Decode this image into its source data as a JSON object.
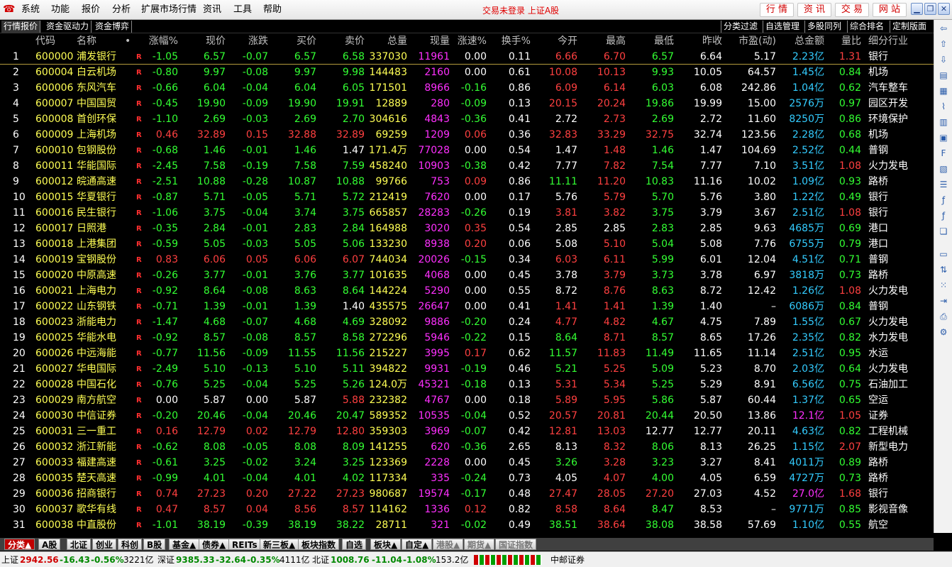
{
  "menu": {
    "logo": "☎",
    "items": [
      "系统",
      "功能",
      "报价",
      "分析",
      "扩展市场行情",
      "资讯",
      "工具",
      "帮助"
    ],
    "login_status": "交易未登录 上证A股",
    "trade_buttons": [
      "行 情",
      "资 讯",
      "交 易",
      "网 站"
    ]
  },
  "tabs": {
    "left": [
      "行情报价",
      "资金驱动力",
      "资金博弈"
    ],
    "right": [
      "分类过滤",
      "自选管理",
      "多股同列",
      "综合排名",
      "定制版面"
    ]
  },
  "columns": [
    "代码",
    "名称",
    "•",
    "涨幅%",
    "现价",
    "涨跌",
    "买价",
    "卖价",
    "总量",
    "现量",
    "涨速%",
    "换手%",
    "今开",
    "最高",
    "最低",
    "昨收",
    "市盈(动)",
    "总金额",
    "量比",
    "细分行业"
  ],
  "r_mark": "R",
  "rows": [
    {
      "no": "1",
      "code": "600000",
      "name": "浦发银行",
      "pct": "-1.05",
      "price": "6.57",
      "chg": "-0.07",
      "bid": "6.57",
      "ask": "6.58",
      "vol": "337030",
      "cur": "11961",
      "spd": "0.00",
      "turn": "0.11",
      "open": "6.66",
      "high": "6.70",
      "low": "6.57",
      "prev": "6.64",
      "pe": "5.17",
      "amt_n": "2.23",
      "amt_u": "亿",
      "ratio": "1.31",
      "ind": "银行"
    },
    {
      "no": "2",
      "code": "600004",
      "name": "白云机场",
      "pct": "-0.80",
      "price": "9.97",
      "chg": "-0.08",
      "bid": "9.97",
      "ask": "9.98",
      "vol": "144483",
      "cur": "2160",
      "spd": "0.00",
      "turn": "0.61",
      "open": "10.08",
      "high": "10.13",
      "low": "9.93",
      "prev": "10.05",
      "pe": "64.57",
      "amt_n": "1.45",
      "amt_u": "亿",
      "ratio": "0.84",
      "ind": "机场"
    },
    {
      "no": "3",
      "code": "600006",
      "name": "东风汽车",
      "pct": "-0.66",
      "price": "6.04",
      "chg": "-0.04",
      "bid": "6.04",
      "ask": "6.05",
      "vol": "171501",
      "cur": "8966",
      "spd": "-0.16",
      "turn": "0.86",
      "open": "6.09",
      "high": "6.14",
      "low": "6.03",
      "prev": "6.08",
      "pe": "242.86",
      "amt_n": "1.04",
      "amt_u": "亿",
      "ratio": "0.62",
      "ind": "汽车整车"
    },
    {
      "no": "4",
      "code": "600007",
      "name": "中国国贸",
      "pct": "-0.45",
      "price": "19.90",
      "chg": "-0.09",
      "bid": "19.90",
      "ask": "19.91",
      "vol": "12889",
      "cur": "280",
      "spd": "-0.09",
      "turn": "0.13",
      "open": "20.15",
      "high": "20.24",
      "low": "19.86",
      "prev": "19.99",
      "pe": "15.00",
      "amt_n": "2576",
      "amt_u": "万",
      "ratio": "0.97",
      "ind": "园区开发"
    },
    {
      "no": "5",
      "code": "600008",
      "name": "首创环保",
      "pct": "-1.10",
      "price": "2.69",
      "chg": "-0.03",
      "bid": "2.69",
      "ask": "2.70",
      "vol": "304616",
      "cur": "4843",
      "spd": "-0.36",
      "turn": "0.41",
      "open": "2.72",
      "high": "2.73",
      "low": "2.69",
      "prev": "2.72",
      "pe": "11.60",
      "amt_n": "8250",
      "amt_u": "万",
      "ratio": "0.86",
      "ind": "环境保护"
    },
    {
      "no": "6",
      "code": "600009",
      "name": "上海机场",
      "pct": "0.46",
      "price": "32.89",
      "chg": "0.15",
      "bid": "32.88",
      "ask": "32.89",
      "vol": "69259",
      "cur": "1209",
      "spd": "0.06",
      "turn": "0.36",
      "open": "32.83",
      "high": "33.29",
      "low": "32.75",
      "prev": "32.74",
      "pe": "123.56",
      "amt_n": "2.28",
      "amt_u": "亿",
      "ratio": "0.68",
      "ind": "机场"
    },
    {
      "no": "7",
      "code": "600010",
      "name": "包钢股份",
      "pct": "-0.68",
      "price": "1.46",
      "chg": "-0.01",
      "bid": "1.46",
      "ask": "1.47",
      "vol": "171.4万",
      "cur": "77028",
      "spd": "0.00",
      "turn": "0.54",
      "open": "1.47",
      "high": "1.48",
      "low": "1.46",
      "prev": "1.47",
      "pe": "104.69",
      "amt_n": "2.52",
      "amt_u": "亿",
      "ratio": "0.44",
      "ind": "普钢"
    },
    {
      "no": "8",
      "code": "600011",
      "name": "华能国际",
      "pct": "-2.45",
      "price": "7.58",
      "chg": "-0.19",
      "bid": "7.58",
      "ask": "7.59",
      "vol": "458240",
      "cur": "10903",
      "spd": "-0.38",
      "turn": "0.42",
      "open": "7.77",
      "high": "7.82",
      "low": "7.54",
      "prev": "7.77",
      "pe": "7.10",
      "amt_n": "3.51",
      "amt_u": "亿",
      "ratio": "1.08",
      "ind": "火力发电"
    },
    {
      "no": "9",
      "code": "600012",
      "name": "皖通高速",
      "pct": "-2.51",
      "price": "10.88",
      "chg": "-0.28",
      "bid": "10.87",
      "ask": "10.88",
      "vol": "99766",
      "cur": "753",
      "spd": "0.09",
      "turn": "0.86",
      "open": "11.11",
      "high": "11.20",
      "low": "10.83",
      "prev": "11.16",
      "pe": "10.02",
      "amt_n": "1.09",
      "amt_u": "亿",
      "ratio": "0.93",
      "ind": "路桥"
    },
    {
      "no": "10",
      "code": "600015",
      "name": "华夏银行",
      "pct": "-0.87",
      "price": "5.71",
      "chg": "-0.05",
      "bid": "5.71",
      "ask": "5.72",
      "vol": "212419",
      "cur": "7620",
      "spd": "0.00",
      "turn": "0.17",
      "open": "5.76",
      "high": "5.79",
      "low": "5.70",
      "prev": "5.76",
      "pe": "3.80",
      "amt_n": "1.22",
      "amt_u": "亿",
      "ratio": "0.49",
      "ind": "银行"
    },
    {
      "no": "11",
      "code": "600016",
      "name": "民生银行",
      "pct": "-1.06",
      "price": "3.75",
      "chg": "-0.04",
      "bid": "3.74",
      "ask": "3.75",
      "vol": "665857",
      "cur": "28283",
      "spd": "-0.26",
      "turn": "0.19",
      "open": "3.81",
      "high": "3.82",
      "low": "3.75",
      "prev": "3.79",
      "pe": "3.67",
      "amt_n": "2.51",
      "amt_u": "亿",
      "ratio": "1.08",
      "ind": "银行"
    },
    {
      "no": "12",
      "code": "600017",
      "name": "日照港",
      "pct": "-0.35",
      "price": "2.84",
      "chg": "-0.01",
      "bid": "2.83",
      "ask": "2.84",
      "vol": "164988",
      "cur": "3020",
      "spd": "0.35",
      "turn": "0.54",
      "open": "2.85",
      "high": "2.85",
      "low": "2.83",
      "prev": "2.85",
      "pe": "9.63",
      "amt_n": "4685",
      "amt_u": "万",
      "ratio": "0.69",
      "ind": "港口"
    },
    {
      "no": "13",
      "code": "600018",
      "name": "上港集团",
      "pct": "-0.59",
      "price": "5.05",
      "chg": "-0.03",
      "bid": "5.05",
      "ask": "5.06",
      "vol": "133230",
      "cur": "8938",
      "spd": "0.20",
      "turn": "0.06",
      "open": "5.08",
      "high": "5.10",
      "low": "5.04",
      "prev": "5.08",
      "pe": "7.76",
      "amt_n": "6755",
      "amt_u": "万",
      "ratio": "0.79",
      "ind": "港口"
    },
    {
      "no": "14",
      "code": "600019",
      "name": "宝钢股份",
      "pct": "0.83",
      "price": "6.06",
      "chg": "0.05",
      "bid": "6.06",
      "ask": "6.07",
      "vol": "744034",
      "cur": "20026",
      "spd": "-0.15",
      "turn": "0.34",
      "open": "6.03",
      "high": "6.11",
      "low": "5.99",
      "prev": "6.01",
      "pe": "12.04",
      "amt_n": "4.51",
      "amt_u": "亿",
      "ratio": "0.71",
      "ind": "普钢"
    },
    {
      "no": "15",
      "code": "600020",
      "name": "中原高速",
      "pct": "-0.26",
      "price": "3.77",
      "chg": "-0.01",
      "bid": "3.76",
      "ask": "3.77",
      "vol": "101635",
      "cur": "4068",
      "spd": "0.00",
      "turn": "0.45",
      "open": "3.78",
      "high": "3.79",
      "low": "3.73",
      "prev": "3.78",
      "pe": "6.97",
      "amt_n": "3818",
      "amt_u": "万",
      "ratio": "0.73",
      "ind": "路桥"
    },
    {
      "no": "16",
      "code": "600021",
      "name": "上海电力",
      "pct": "-0.92",
      "price": "8.64",
      "chg": "-0.08",
      "bid": "8.63",
      "ask": "8.64",
      "vol": "144224",
      "cur": "5290",
      "spd": "0.00",
      "turn": "0.55",
      "open": "8.72",
      "high": "8.76",
      "low": "8.63",
      "prev": "8.72",
      "pe": "12.42",
      "amt_n": "1.26",
      "amt_u": "亿",
      "ratio": "1.08",
      "ind": "火力发电"
    },
    {
      "no": "17",
      "code": "600022",
      "name": "山东钢铁",
      "pct": "-0.71",
      "price": "1.39",
      "chg": "-0.01",
      "bid": "1.39",
      "ask": "1.40",
      "vol": "435575",
      "cur": "26647",
      "spd": "0.00",
      "turn": "0.41",
      "open": "1.41",
      "high": "1.41",
      "low": "1.39",
      "prev": "1.40",
      "pe": "–",
      "amt_n": "6086",
      "amt_u": "万",
      "ratio": "0.84",
      "ind": "普钢"
    },
    {
      "no": "18",
      "code": "600023",
      "name": "浙能电力",
      "pct": "-1.47",
      "price": "4.68",
      "chg": "-0.07",
      "bid": "4.68",
      "ask": "4.69",
      "vol": "328092",
      "cur": "9886",
      "spd": "-0.20",
      "turn": "0.24",
      "open": "4.77",
      "high": "4.82",
      "low": "4.67",
      "prev": "4.75",
      "pe": "7.89",
      "amt_n": "1.55",
      "amt_u": "亿",
      "ratio": "0.67",
      "ind": "火力发电"
    },
    {
      "no": "19",
      "code": "600025",
      "name": "华能水电",
      "pct": "-0.92",
      "price": "8.57",
      "chg": "-0.08",
      "bid": "8.57",
      "ask": "8.58",
      "vol": "272296",
      "cur": "5946",
      "spd": "-0.22",
      "turn": "0.15",
      "open": "8.64",
      "high": "8.71",
      "low": "8.57",
      "prev": "8.65",
      "pe": "17.26",
      "amt_n": "2.35",
      "amt_u": "亿",
      "ratio": "0.82",
      "ind": "水力发电"
    },
    {
      "no": "20",
      "code": "600026",
      "name": "中远海能",
      "pct": "-0.77",
      "price": "11.56",
      "chg": "-0.09",
      "bid": "11.55",
      "ask": "11.56",
      "vol": "215227",
      "cur": "3995",
      "spd": "0.17",
      "turn": "0.62",
      "open": "11.57",
      "high": "11.83",
      "low": "11.49",
      "prev": "11.65",
      "pe": "11.14",
      "amt_n": "2.51",
      "amt_u": "亿",
      "ratio": "0.95",
      "ind": "水运"
    },
    {
      "no": "21",
      "code": "600027",
      "name": "华电国际",
      "pct": "-2.49",
      "price": "5.10",
      "chg": "-0.13",
      "bid": "5.10",
      "ask": "5.11",
      "vol": "394822",
      "cur": "9931",
      "spd": "-0.19",
      "turn": "0.46",
      "open": "5.21",
      "high": "5.25",
      "low": "5.09",
      "prev": "5.23",
      "pe": "8.70",
      "amt_n": "2.03",
      "amt_u": "亿",
      "ratio": "0.64",
      "ind": "火力发电"
    },
    {
      "no": "22",
      "code": "600028",
      "name": "中国石化",
      "pct": "-0.76",
      "price": "5.25",
      "chg": "-0.04",
      "bid": "5.25",
      "ask": "5.26",
      "vol": "124.0万",
      "cur": "45321",
      "spd": "-0.18",
      "turn": "0.13",
      "open": "5.31",
      "high": "5.34",
      "low": "5.25",
      "prev": "5.29",
      "pe": "8.91",
      "amt_n": "6.56",
      "amt_u": "亿",
      "ratio": "0.75",
      "ind": "石油加工"
    },
    {
      "no": "23",
      "code": "600029",
      "name": "南方航空",
      "pct": "0.00",
      "price": "5.87",
      "chg": "0.00",
      "bid": "5.87",
      "ask": "5.88",
      "vol": "232382",
      "cur": "4767",
      "spd": "0.00",
      "turn": "0.18",
      "open": "5.89",
      "high": "5.95",
      "low": "5.86",
      "prev": "5.87",
      "pe": "60.44",
      "amt_n": "1.37",
      "amt_u": "亿",
      "ratio": "0.65",
      "ind": "空运"
    },
    {
      "no": "24",
      "code": "600030",
      "name": "中信证券",
      "pct": "-0.20",
      "price": "20.46",
      "chg": "-0.04",
      "bid": "20.46",
      "ask": "20.47",
      "vol": "589352",
      "cur": "10535",
      "spd": "-0.04",
      "turn": "0.52",
      "open": "20.57",
      "high": "20.81",
      "low": "20.44",
      "prev": "20.50",
      "pe": "13.86",
      "amt_n": "12.1",
      "amt_u": "亿",
      "ratio": "1.05",
      "ind": "证券"
    },
    {
      "no": "25",
      "code": "600031",
      "name": "三一重工",
      "pct": "0.16",
      "price": "12.79",
      "chg": "0.02",
      "bid": "12.79",
      "ask": "12.80",
      "vol": "359303",
      "cur": "3969",
      "spd": "-0.07",
      "turn": "0.42",
      "open": "12.81",
      "high": "13.03",
      "low": "12.77",
      "prev": "12.77",
      "pe": "20.11",
      "amt_n": "4.63",
      "amt_u": "亿",
      "ratio": "0.82",
      "ind": "工程机械"
    },
    {
      "no": "26",
      "code": "600032",
      "name": "浙江新能",
      "pct": "-0.62",
      "price": "8.08",
      "chg": "-0.05",
      "bid": "8.08",
      "ask": "8.09",
      "vol": "141255",
      "cur": "620",
      "spd": "-0.36",
      "turn": "2.65",
      "open": "8.13",
      "high": "8.32",
      "low": "8.06",
      "prev": "8.13",
      "pe": "26.25",
      "amt_n": "1.15",
      "amt_u": "亿",
      "ratio": "2.07",
      "ind": "新型电力"
    },
    {
      "no": "27",
      "code": "600033",
      "name": "福建高速",
      "pct": "-0.61",
      "price": "3.25",
      "chg": "-0.02",
      "bid": "3.24",
      "ask": "3.25",
      "vol": "123369",
      "cur": "2228",
      "spd": "0.00",
      "turn": "0.45",
      "open": "3.26",
      "high": "3.28",
      "low": "3.23",
      "prev": "3.27",
      "pe": "8.41",
      "amt_n": "4011",
      "amt_u": "万",
      "ratio": "0.89",
      "ind": "路桥"
    },
    {
      "no": "28",
      "code": "600035",
      "name": "楚天高速",
      "pct": "-0.99",
      "price": "4.01",
      "chg": "-0.04",
      "bid": "4.01",
      "ask": "4.02",
      "vol": "117334",
      "cur": "335",
      "spd": "-0.24",
      "turn": "0.73",
      "open": "4.05",
      "high": "4.07",
      "low": "4.00",
      "prev": "4.05",
      "pe": "6.59",
      "amt_n": "4727",
      "amt_u": "万",
      "ratio": "0.73",
      "ind": "路桥"
    },
    {
      "no": "29",
      "code": "600036",
      "name": "招商银行",
      "pct": "0.74",
      "price": "27.23",
      "chg": "0.20",
      "bid": "27.22",
      "ask": "27.23",
      "vol": "980687",
      "cur": "19574",
      "spd": "-0.17",
      "turn": "0.48",
      "open": "27.47",
      "high": "28.05",
      "low": "27.20",
      "prev": "27.03",
      "pe": "4.52",
      "amt_n": "27.0",
      "amt_u": "亿",
      "ratio": "1.68",
      "ind": "银行"
    },
    {
      "no": "30",
      "code": "600037",
      "name": "歌华有线",
      "pct": "0.47",
      "price": "8.57",
      "chg": "0.04",
      "bid": "8.56",
      "ask": "8.57",
      "vol": "114162",
      "cur": "1336",
      "spd": "0.12",
      "turn": "0.82",
      "open": "8.58",
      "high": "8.64",
      "low": "8.47",
      "prev": "8.53",
      "pe": "–",
      "amt_n": "9771",
      "amt_u": "万",
      "ratio": "0.85",
      "ind": "影视音像"
    },
    {
      "no": "31",
      "code": "600038",
      "name": "中直股份",
      "pct": "-1.01",
      "price": "38.19",
      "chg": "-0.39",
      "bid": "38.19",
      "ask": "38.22",
      "vol": "28711",
      "cur": "321",
      "spd": "-0.02",
      "turn": "0.49",
      "open": "38.51",
      "high": "38.64",
      "low": "38.08",
      "prev": "38.58",
      "pe": "57.69",
      "amt_n": "1.10",
      "amt_u": "亿",
      "ratio": "0.55",
      "ind": "航空"
    }
  ],
  "sheet_tabs": [
    "分类▲",
    "A股",
    "北证",
    "创业",
    "科创",
    "B股",
    "基金▲",
    "债券▲",
    "REITs",
    "新三板▲",
    "板块指数",
    "自选",
    "板块▲",
    "自定▲",
    "港股▲",
    "期货▲",
    "国证指数"
  ],
  "status": {
    "sh_label": "上证",
    "sh_index": "2942.56",
    "sh_chg": "-16.43",
    "sh_pct": "-0.56%",
    "sh_amt": "3221亿",
    "sz_label": "深证",
    "sz_index": "9385.33",
    "sz_chg": "-32.64",
    "sz_pct": "-0.35%",
    "sz_amt": "4111亿",
    "bz_label": "北证",
    "bz_index": "1008.76",
    "bz_chg": "-11.04",
    "bz_pct": "-1.08%",
    "bz_amt": "153.2亿",
    "broker": "中邮证券"
  },
  "colors": {
    "up": "#ff4040",
    "down": "#33ff33",
    "flat": "#ffffff",
    "code": "#ffff55",
    "name": "#ffff55",
    "volume": "#ffff55",
    "cur_volume": "#ff30ff",
    "amount": "#33ccff",
    "industry": "#ffffff",
    "index_no": "#ffffff"
  }
}
